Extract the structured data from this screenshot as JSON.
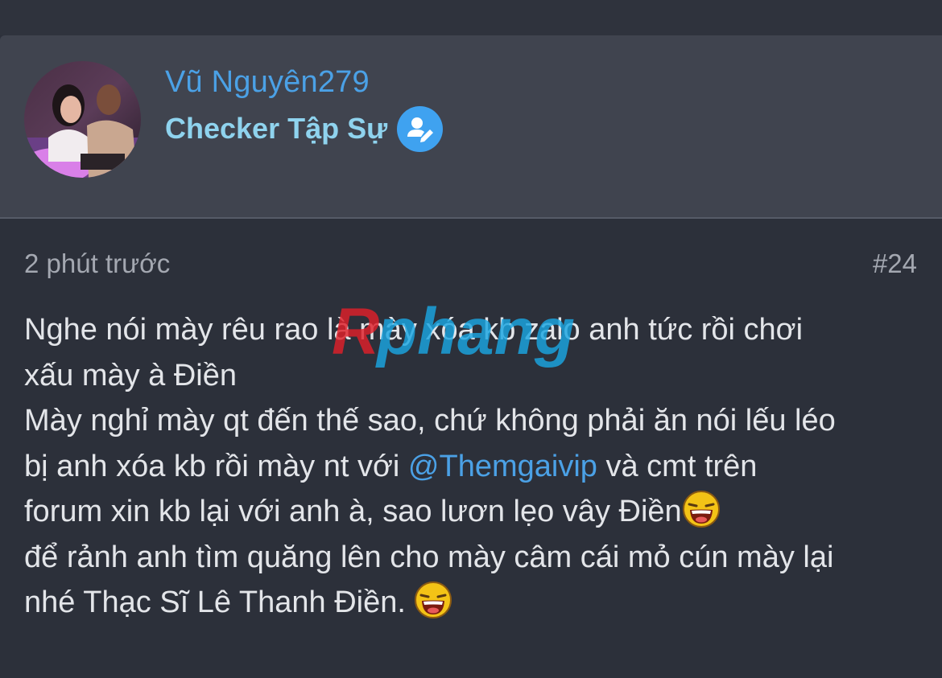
{
  "user": {
    "name": "Vũ Nguyên279",
    "role": "Checker Tập Sự"
  },
  "post": {
    "timestamp": "2 phút trước",
    "number": "#24",
    "lines": [
      "Nghe nói mày rêu rao là mày xóa kb zalo anh tức rồi chơi",
      "xấu mày à Điền",
      "Mày nghỉ mày qt đến thế sao, chứ không phải ăn nói lếu léo",
      "bị anh xóa kb rồi mày nt với ",
      " và cmt trên",
      "forum xin kb lại với anh à, sao lươn lẹo vây Điền",
      "để rảnh anh tìm quăng lên cho mày câm cái mỏ cún mày lại",
      "nhé Thạc Sĩ Lê Thanh Điền. "
    ],
    "mention": "@Themgaivip"
  },
  "watermark": {
    "text_red": "R",
    "text_blue": "phang"
  },
  "colors": {
    "background": "#2c303a",
    "header_background": "#40444f",
    "username": "#4ba1e6",
    "role": "#8fd3ee",
    "mention": "#4ba1e6",
    "body_text": "#e3e5e9",
    "meta_text": "#a4a8b1"
  },
  "icons": {
    "role_badge": "user-edit-icon",
    "emoji": "laughing-emoji-icon"
  }
}
